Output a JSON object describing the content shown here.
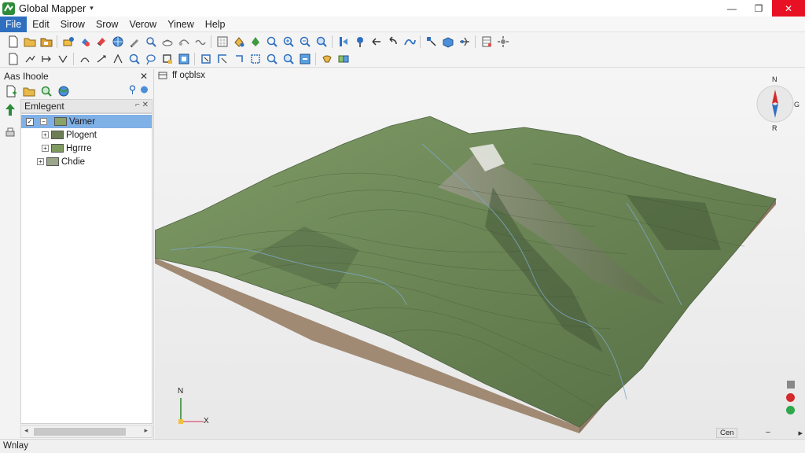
{
  "app": {
    "title": "Global Mapper",
    "title_caret": "▾"
  },
  "window_controls": {
    "minimize": "—",
    "restore": "❐",
    "close": "✕"
  },
  "menu": [
    {
      "label": "File",
      "active": true
    },
    {
      "label": "Edit"
    },
    {
      "label": "Sirow"
    },
    {
      "label": "Srow"
    },
    {
      "label": "Verow"
    },
    {
      "label": "Yinew"
    },
    {
      "label": "Help"
    }
  ],
  "panel": {
    "title": "Aas Ihoole",
    "close": "✕",
    "subheader": "Emlegent",
    "subheader_controls": "⌐ ✕",
    "tree": [
      {
        "label": "Vamer",
        "selected": true,
        "checked": true,
        "thumb": "#8aa26a"
      },
      {
        "label": "Plogent",
        "selected": false,
        "checked": false,
        "thumb": "#6d7d55"
      },
      {
        "label": "Hgrrre",
        "selected": false,
        "checked": false,
        "thumb": "#7f9a60"
      },
      {
        "label": "Chdie",
        "selected": false,
        "checked": false,
        "thumb": "#9aa58a"
      }
    ],
    "scroll_left": "◂",
    "scroll_right": "▸"
  },
  "viewport": {
    "tab_label": "ff oçblsx",
    "compass": {
      "north": "N",
      "south": "R",
      "east": "G"
    },
    "gizmo": {
      "north": "N",
      "x": "X"
    },
    "footer": {
      "button": "Cen",
      "minus": "−",
      "arrow": "▸"
    }
  },
  "status": {
    "text": "Wnlay"
  },
  "colors": {
    "menu_active": "#2f6fc0",
    "tree_selected": "#7fb0e6",
    "close_button": "#e81123",
    "terrain_green": "#6f8a5a",
    "terrain_dark": "#46593a",
    "terrain_side": "#a08a74"
  },
  "icons": {
    "toolbar1": [
      "new-document-icon",
      "open-folder-icon",
      "save-icon",
      "layers-icon",
      "hand-icon",
      "eraser-icon",
      "globe-icon",
      "pen-icon",
      "select-icon",
      "cloud-icon",
      "link-icon",
      "tilde-icon",
      "grid-icon",
      "fill-icon",
      "vertex-icon",
      "zoom-icon",
      "zoom-in-icon",
      "zoom-out-icon",
      "zoom-extent-icon",
      "feature-icon",
      "pin-icon",
      "arrow-left-icon",
      "undo-icon",
      "route-icon",
      "path-icon",
      "box-3d-icon",
      "fly-icon",
      "table-icon",
      "settings-icon"
    ],
    "toolbar2": [
      "page-icon",
      "move-icon",
      "line-icon",
      "split-icon",
      "curve-icon",
      "draw-icon",
      "measure-icon",
      "search-icon",
      "lasso-icon",
      "crop-icon",
      "frame-icon",
      "snap-icon",
      "corner-icon",
      "rect-icon",
      "box-select-icon",
      "zoom-a-icon",
      "magnifier-icon",
      "pick-icon",
      "filter-icon",
      "merge-icon"
    ]
  }
}
